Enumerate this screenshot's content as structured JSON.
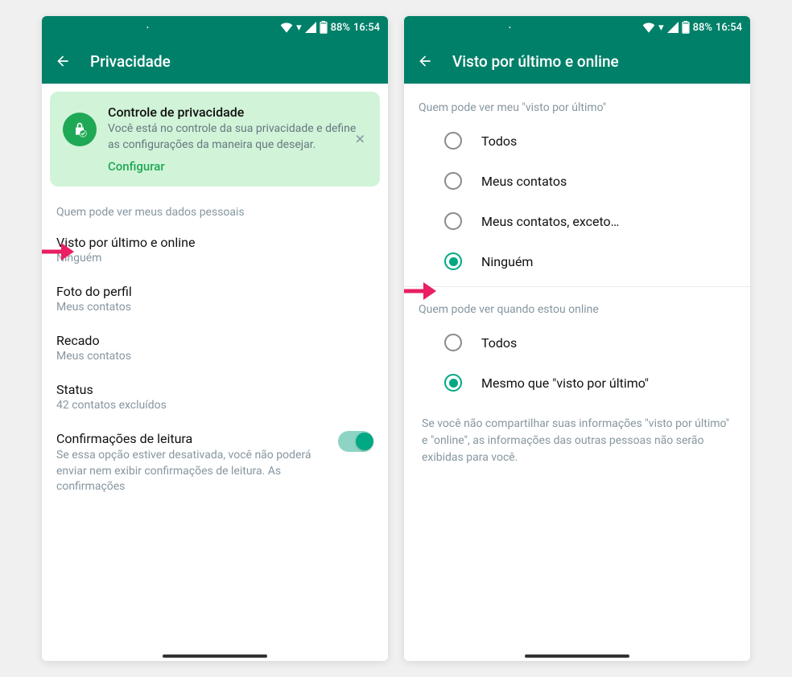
{
  "status": {
    "battery": "88%",
    "time": "16:54"
  },
  "screen1": {
    "title": "Privacidade",
    "banner": {
      "title": "Controle de privacidade",
      "desc": "Você está no controle da sua privacidade e define as configurações da maneira que desejar.",
      "link": "Configurar"
    },
    "section_header": "Quem pode ver meus dados pessoais",
    "items": [
      {
        "title": "Visto por último e online",
        "value": "Ninguém"
      },
      {
        "title": "Foto do perfil",
        "value": "Meus contatos"
      },
      {
        "title": "Recado",
        "value": "Meus contatos"
      },
      {
        "title": "Status",
        "value": "42 contatos excluídos"
      }
    ],
    "read_receipts": {
      "title": "Confirmações de leitura",
      "desc": "Se essa opção estiver desativada, você não poderá enviar nem exibir confirmações de leitura. As confirmações"
    }
  },
  "screen2": {
    "title": "Visto por último e online",
    "section1_header": "Quem pode ver meu \"visto por último\"",
    "options1": [
      "Todos",
      "Meus contatos",
      "Meus contatos, exceto…",
      "Ninguém"
    ],
    "selected1": 3,
    "section2_header": "Quem pode ver quando estou online",
    "options2": [
      "Todos",
      "Mesmo que \"visto por último\""
    ],
    "selected2": 1,
    "footer": "Se você não compartilhar suas informações \"visto por último\" e \"online\", as informações das outras pessoas não serão exibidas para você."
  }
}
